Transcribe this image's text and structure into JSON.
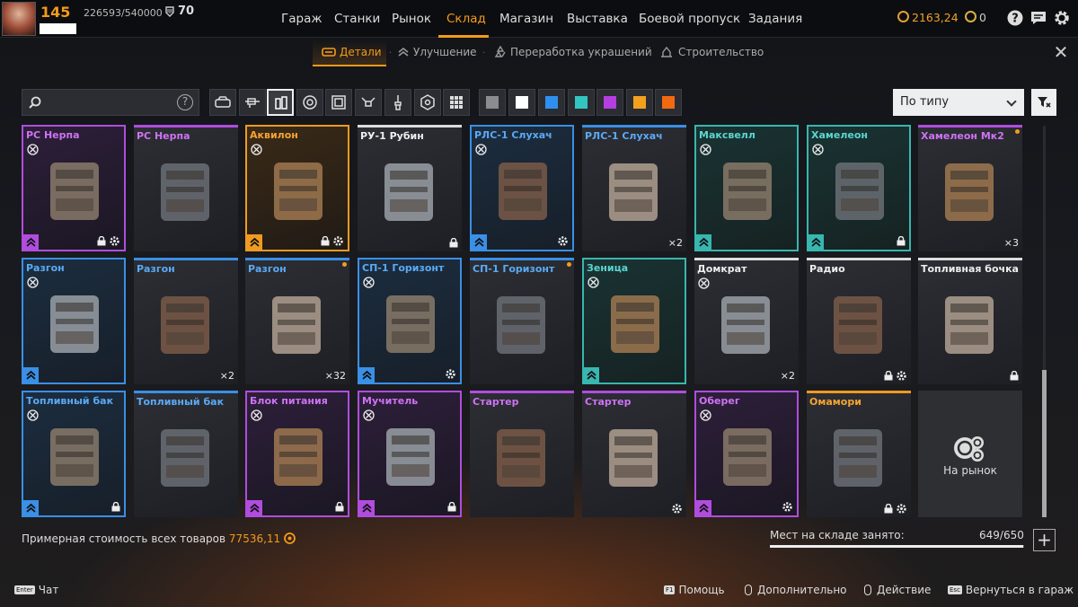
{
  "header": {
    "level": "145",
    "xp": "226593/540000",
    "badge_count": "70",
    "coins": "2163,24",
    "tokens": "0"
  },
  "nav": [
    {
      "label": "Гараж",
      "active": false
    },
    {
      "label": "Станки",
      "active": false
    },
    {
      "label": "Рынок",
      "active": false
    },
    {
      "label": "Склад",
      "active": true
    },
    {
      "label": "Магазин",
      "active": false
    },
    {
      "label": "Выставка",
      "active": false
    },
    {
      "label": "Боевой пропуск",
      "active": false
    },
    {
      "label": "Задания",
      "active": false
    }
  ],
  "subtabs": [
    {
      "label": "Детали",
      "active": true
    },
    {
      "label": "Улучшение",
      "active": false
    },
    {
      "label": "Переработка украшений",
      "active": false
    },
    {
      "label": "Строительство",
      "active": false
    }
  ],
  "filters": {
    "search_placeholder": "",
    "sort_label": "По типу",
    "type_icons": [
      "cabin-icon",
      "weapon-icon",
      "module-icon",
      "wheel-icon",
      "frame-icon",
      "drone-icon",
      "paint-icon",
      "hex-icon",
      "grid-icon"
    ],
    "rarity_colors": [
      "#8a8c90",
      "#ffffff",
      "#2f8ff0",
      "#33c6c0",
      "#b43fe0",
      "#f2a11f",
      "#f26a10"
    ]
  },
  "items": [
    {
      "name": "РС Нерпа",
      "rarity": "purple",
      "frame": "full",
      "tool": true,
      "rank": true,
      "lock": true,
      "gear": true,
      "count": "",
      "new": false
    },
    {
      "name": "РС Нерпа",
      "rarity": "purple",
      "frame": "top",
      "tool": false,
      "rank": false,
      "lock": false,
      "gear": false,
      "count": "",
      "new": false
    },
    {
      "name": "Аквилон",
      "rarity": "orange",
      "frame": "full",
      "tool": true,
      "rank": true,
      "lock": true,
      "gear": true,
      "count": "",
      "new": false
    },
    {
      "name": "РУ-1 Рубин",
      "rarity": "white",
      "frame": "top",
      "tool": false,
      "rank": false,
      "lock": true,
      "gear": false,
      "count": "",
      "new": false
    },
    {
      "name": "РЛС-1 Слухач",
      "rarity": "blue",
      "frame": "full",
      "tool": true,
      "rank": true,
      "lock": false,
      "gear": true,
      "count": "",
      "new": false
    },
    {
      "name": "РЛС-1 Слухач",
      "rarity": "blue",
      "frame": "top",
      "tool": false,
      "rank": false,
      "lock": false,
      "gear": false,
      "count": "×2",
      "new": false
    },
    {
      "name": "Максвелл",
      "rarity": "teal",
      "frame": "full",
      "tool": true,
      "rank": true,
      "lock": false,
      "gear": false,
      "count": "",
      "new": false
    },
    {
      "name": "Хамелеон",
      "rarity": "teal",
      "frame": "full",
      "tool": true,
      "rank": true,
      "lock": true,
      "gear": false,
      "count": "",
      "new": false
    },
    {
      "name": "Хамелеон Мк2",
      "rarity": "purple",
      "frame": "top",
      "tool": false,
      "rank": false,
      "lock": false,
      "gear": false,
      "count": "×3",
      "new": true
    },
    {
      "name": "Разгон",
      "rarity": "blue",
      "frame": "full",
      "tool": true,
      "rank": true,
      "lock": false,
      "gear": false,
      "count": "",
      "new": false
    },
    {
      "name": "Разгон",
      "rarity": "blue",
      "frame": "top",
      "tool": false,
      "rank": false,
      "lock": false,
      "gear": false,
      "count": "×2",
      "new": false
    },
    {
      "name": "Разгон",
      "rarity": "blue",
      "frame": "top",
      "tool": false,
      "rank": false,
      "lock": false,
      "gear": false,
      "count": "×32",
      "new": true
    },
    {
      "name": "СП-1 Горизонт",
      "rarity": "blue",
      "frame": "full",
      "tool": true,
      "rank": true,
      "lock": false,
      "gear": true,
      "count": "",
      "new": false
    },
    {
      "name": "СП-1 Горизонт",
      "rarity": "blue",
      "frame": "top",
      "tool": false,
      "rank": false,
      "lock": false,
      "gear": false,
      "count": "",
      "new": true
    },
    {
      "name": "Зеница",
      "rarity": "teal",
      "frame": "full",
      "tool": true,
      "rank": true,
      "lock": false,
      "gear": false,
      "count": "",
      "new": false
    },
    {
      "name": "Домкрат",
      "rarity": "white",
      "frame": "top",
      "tool": true,
      "rank": false,
      "lock": false,
      "gear": false,
      "count": "×2",
      "new": false
    },
    {
      "name": "Радио",
      "rarity": "white",
      "frame": "top",
      "tool": false,
      "rank": false,
      "lock": true,
      "gear": true,
      "count": "",
      "new": false
    },
    {
      "name": "Топливная бочка",
      "rarity": "white",
      "frame": "top",
      "tool": false,
      "rank": false,
      "lock": true,
      "gear": false,
      "count": "",
      "new": false
    },
    {
      "name": "Топливный бак",
      "rarity": "blue",
      "frame": "full",
      "tool": true,
      "rank": true,
      "lock": true,
      "gear": false,
      "count": "",
      "new": false
    },
    {
      "name": "Топливный бак",
      "rarity": "blue",
      "frame": "top",
      "tool": false,
      "rank": false,
      "lock": false,
      "gear": false,
      "count": "",
      "new": false
    },
    {
      "name": "Блок питания",
      "rarity": "purple",
      "frame": "full",
      "tool": true,
      "rank": true,
      "lock": true,
      "gear": false,
      "count": "",
      "new": false
    },
    {
      "name": "Мучитель",
      "rarity": "purple",
      "frame": "full",
      "tool": true,
      "rank": true,
      "lock": true,
      "gear": false,
      "count": "",
      "new": false
    },
    {
      "name": "Стартер",
      "rarity": "purple",
      "frame": "top",
      "tool": false,
      "rank": false,
      "lock": false,
      "gear": false,
      "count": "",
      "new": false
    },
    {
      "name": "Стартер",
      "rarity": "purple",
      "frame": "top",
      "tool": false,
      "rank": false,
      "lock": false,
      "gear": true,
      "count": "",
      "new": false
    },
    {
      "name": "Оберег",
      "rarity": "purple",
      "frame": "full",
      "tool": true,
      "rank": true,
      "lock": false,
      "gear": true,
      "count": "",
      "new": false
    },
    {
      "name": "Омамори",
      "rarity": "orange",
      "frame": "top",
      "tool": false,
      "rank": false,
      "lock": true,
      "gear": true,
      "count": "",
      "new": false
    }
  ],
  "market_card": {
    "label": "На рынок"
  },
  "footer": {
    "total_label": "Примерная стоимость всех товаров",
    "total_value": "77536,11",
    "storage_label": "Мест на складе занято:",
    "storage_value": "649/650",
    "storage_fraction": 0.998,
    "hints": [
      {
        "key": "Enter",
        "label": "Чат"
      },
      {
        "key": "F1",
        "label": "Помощь"
      },
      {
        "key": "mouse",
        "label": "Дополнительно"
      },
      {
        "key": "mouse",
        "label": "Действие"
      },
      {
        "key": "Esc",
        "label": "Вернуться в гараж"
      }
    ]
  }
}
